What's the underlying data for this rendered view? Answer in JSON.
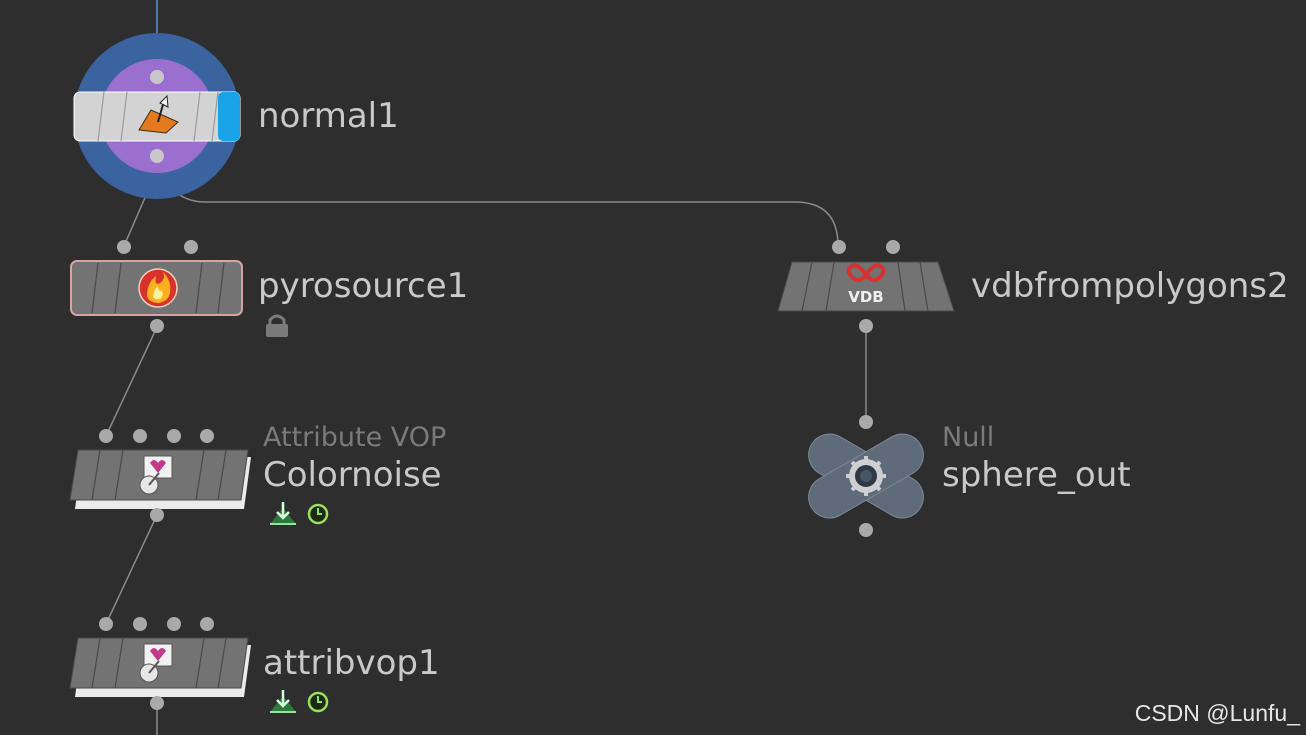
{
  "nodes": {
    "normal": {
      "name": "normal1"
    },
    "pyrosource": {
      "name": "pyrosource1"
    },
    "colornoise": {
      "type": "Attribute VOP",
      "name": "Colornoise"
    },
    "attribvop": {
      "name": "attribvop1"
    },
    "vdb": {
      "name": "vdbfrompolygons2",
      "icon_text": "VDB"
    },
    "null": {
      "type": "Null",
      "name": "sphere_out"
    }
  },
  "watermark": "CSDN @Lunfu_"
}
